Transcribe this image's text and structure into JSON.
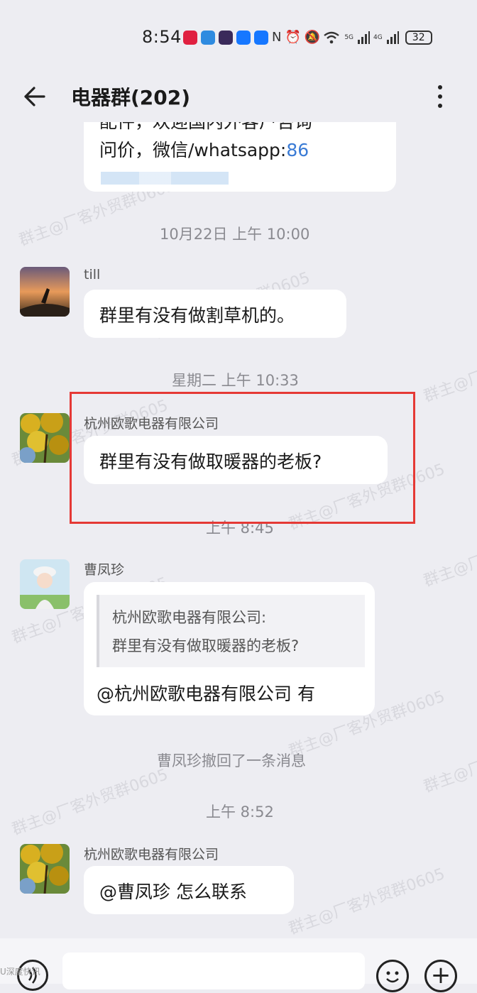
{
  "status_bar": {
    "time": "8:54",
    "network_5g": "5G",
    "network_4g": "4G",
    "battery": "32",
    "icons": [
      "app-icon-red",
      "weather-icon",
      "game-icon",
      "alipay-icon",
      "alipay-icon",
      "nfc-icon",
      "alarm-icon",
      "mute-icon",
      "wifi-icon",
      "signal-icon",
      "signal-icon",
      "battery-icon"
    ]
  },
  "header": {
    "title": "电器群(202)",
    "back_icon": "arrow-left-icon",
    "more_icon": "more-vertical-icon"
  },
  "messages": [
    {
      "partial_line_1": "配件，欢迎国内外客户咨询",
      "partial_line_2": "问价，微信/whatsapp:",
      "phone_prefix": "86"
    },
    {
      "timestamp": "10月22日  上午 10:00"
    },
    {
      "sender": "till",
      "text": "群里有没有做割草机的。"
    },
    {
      "timestamp": "星期二  上午 10:33"
    },
    {
      "sender": "杭州欧歌电器有限公司",
      "text": "群里有没有做取暖器的老板?"
    },
    {
      "timestamp": "上午 8:45"
    },
    {
      "sender": "曹凤珍",
      "quote_line_1": "杭州欧歌电器有限公司:",
      "quote_line_2": "群里有没有做取暖器的老板?",
      "text": "@杭州欧歌电器有限公司 有"
    },
    {
      "system": "曹凤珍撤回了一条消息"
    },
    {
      "timestamp": "上午 8:52"
    },
    {
      "sender": "杭州欧歌电器有限公司",
      "text": "@曹凤珍  怎么联系"
    }
  ],
  "watermark": "群主@厂客外贸群0605",
  "input": {
    "placeholder": ""
  },
  "source_mark": "U深度快讯"
}
